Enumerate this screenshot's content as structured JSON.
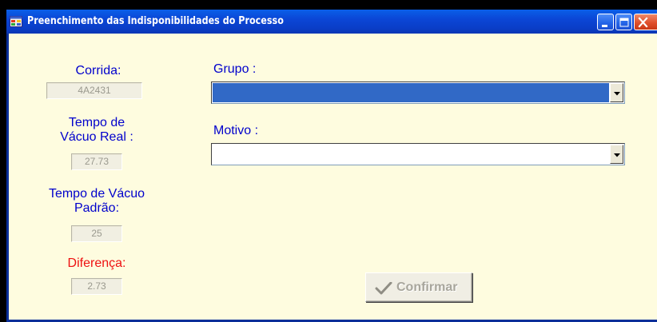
{
  "window": {
    "title": "Preenchimento das Indisponibilidades do Processo",
    "icon": "application-form-icon",
    "controls": [
      "minimize-icon",
      "maximize-icon",
      "close-icon"
    ]
  },
  "form": {
    "corrida": {
      "label": "Corrida:",
      "value": "4A2431"
    },
    "tempo_vacuo_real": {
      "label_line1": "Tempo de",
      "label_line2": "Vácuo Real :",
      "value": "27.73"
    },
    "tempo_vacuo_padrao": {
      "label_line1": "Tempo de Vácuo",
      "label_line2": "Padrão:",
      "value": "25"
    },
    "diferenca": {
      "label": "Diferença:",
      "value": "2.73"
    },
    "grupo": {
      "label": "Grupo :",
      "value": ""
    },
    "motivo": {
      "label": "Motivo :",
      "value": ""
    },
    "confirm_button": {
      "label": "Confirmar",
      "icon": "checkmark-icon",
      "enabled": false
    }
  },
  "colors": {
    "title_bar": "#0b46d6",
    "client_bg": "#fefcdf",
    "label_blue": "#0000cc",
    "label_red": "#ee1111",
    "selection": "#3169c6"
  }
}
